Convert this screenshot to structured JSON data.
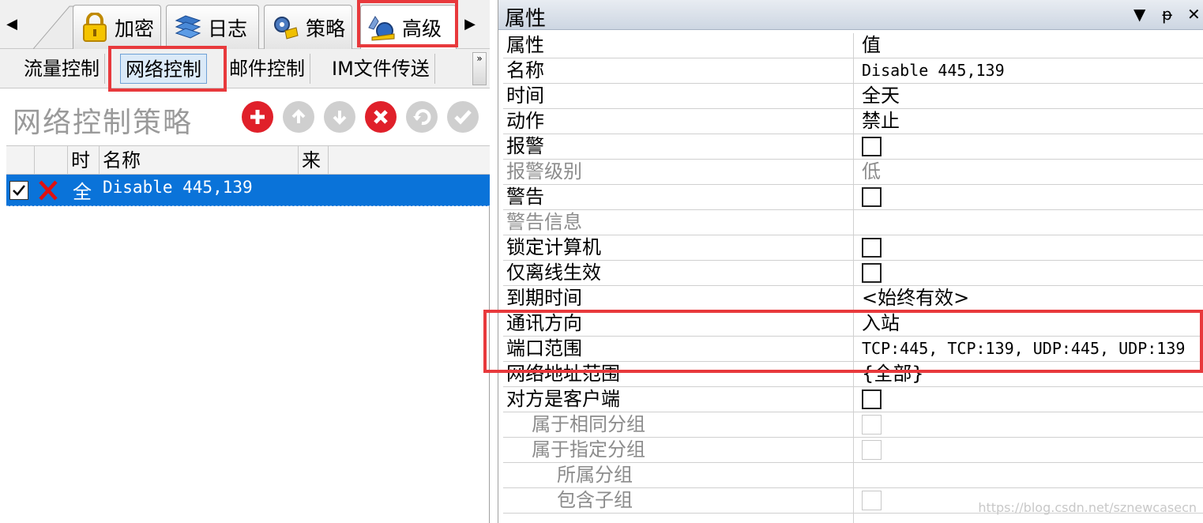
{
  "tabs": [
    {
      "label": "加密",
      "icon": "lock-icon"
    },
    {
      "label": "日志",
      "icon": "log-stack-icon"
    },
    {
      "label": "策略",
      "icon": "policy-gear-icon"
    },
    {
      "label": "高级",
      "icon": "advanced-tools-icon"
    }
  ],
  "subtabs": [
    "流量控制",
    "网络控制",
    "邮件控制",
    "IM文件传送"
  ],
  "policy": {
    "title": "网络控制策略",
    "toolbar": [
      "add-icon",
      "move-up-icon",
      "move-down-icon",
      "delete-icon",
      "undo-icon",
      "apply-check-icon"
    ]
  },
  "grid": {
    "headers": {
      "time": "时",
      "name": "名称",
      "source": "来"
    },
    "row": {
      "time": "全",
      "name": "Disable 445,139"
    }
  },
  "properties": {
    "title": "属性",
    "controls": {
      "dropdown": "▼",
      "pin": "ᵽ",
      "close": "✕"
    },
    "header": {
      "name": "属性",
      "value": "值"
    },
    "rows": [
      {
        "name": "名称",
        "value": "Disable 445,139"
      },
      {
        "name": "时间",
        "value": "全天"
      },
      {
        "name": "动作",
        "value": "禁止"
      },
      {
        "name": "报警",
        "value": ""
      },
      {
        "name": "报警级别",
        "value": "低"
      },
      {
        "name": "警告",
        "value": ""
      },
      {
        "name": "警告信息",
        "value": ""
      },
      {
        "name": "锁定计算机",
        "value": ""
      },
      {
        "name": "仅离线生效",
        "value": ""
      },
      {
        "name": "到期时间",
        "value": "<始终有效>"
      },
      {
        "name": "通讯方向",
        "value": "入站"
      },
      {
        "name": "端口范围",
        "value": "TCP:445, TCP:139, UDP:445, UDP:139"
      },
      {
        "name": "网络地址范围",
        "value": "{全部}"
      },
      {
        "name": "对方是客户端",
        "value": ""
      },
      {
        "name": "属于相同分组",
        "value": ""
      },
      {
        "name": "属于指定分组",
        "value": ""
      },
      {
        "name": "所属分组",
        "value": ""
      },
      {
        "name": "包含子组",
        "value": ""
      }
    ]
  },
  "watermark": "https://blog.csdn.net/sznewcasecn",
  "colors": {
    "selection": "#0a73d9",
    "highlight": "#e8393c"
  }
}
